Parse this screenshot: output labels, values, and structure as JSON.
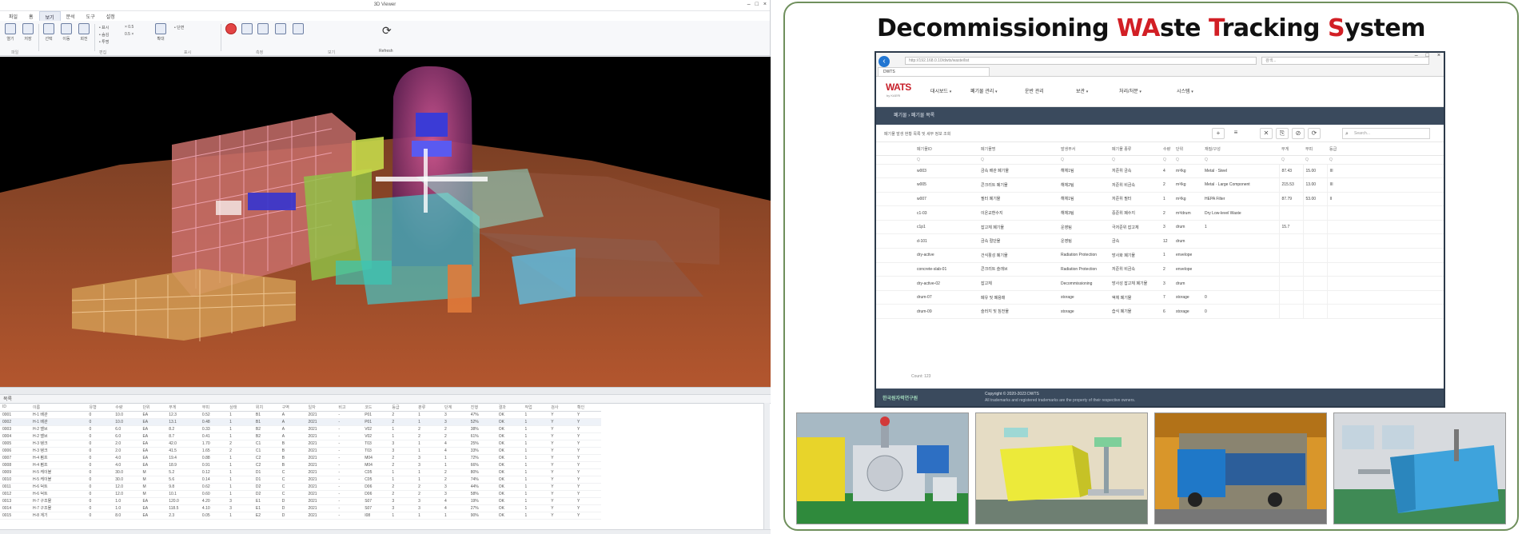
{
  "left_app": {
    "window_title": "3D Viewer",
    "window_controls": [
      "–",
      "□",
      "×"
    ],
    "ribbon_tabs": [
      "파일",
      "홈",
      "보기",
      "분석",
      "도구",
      "설정"
    ],
    "ribbon_active_tab": "보기",
    "ribbon_buttons": [
      "열기",
      "저장",
      "선택",
      "이동",
      "회전",
      "확대"
    ],
    "ribbon_small": [
      "• 표시",
      "• 숨김",
      "• 투명",
      "× 0.5",
      "0.5 ×",
      "• 단면"
    ],
    "ribbon_groups": [
      "파일",
      "편집",
      "표시",
      "측정",
      "보기"
    ],
    "refresh_label": "Refresh",
    "panel_strip": "목록",
    "grid_headers": [
      "ID",
      "이름",
      "유형",
      "수량",
      "단위",
      "무게",
      "부피",
      "상태",
      "위치",
      "구역",
      "일자",
      "비고",
      "코드",
      "등급",
      "분류",
      "단계",
      "진행",
      "결과",
      "작업",
      "검사",
      "확인"
    ],
    "grid_rows": [
      [
        "0001",
        "H-1 배관",
        "0",
        "10.0",
        "EA",
        "12.3",
        "0.52",
        "1",
        "B1",
        "A",
        "2021",
        "-",
        "P01",
        "2",
        "1",
        "3",
        "47%",
        "OK",
        "1",
        "Y",
        "Y"
      ],
      [
        "0002",
        "H-1 배관",
        "0",
        "10.0",
        "EA",
        "13.1",
        "0.48",
        "1",
        "B1",
        "A",
        "2021",
        "-",
        "P01",
        "2",
        "1",
        "3",
        "52%",
        "OK",
        "1",
        "Y",
        "Y"
      ],
      [
        "0003",
        "H-2 밸브",
        "0",
        "6.0",
        "EA",
        "8.2",
        "0.33",
        "1",
        "B2",
        "A",
        "2021",
        "-",
        "V02",
        "1",
        "2",
        "2",
        "38%",
        "OK",
        "1",
        "Y",
        "Y"
      ],
      [
        "0004",
        "H-2 밸브",
        "0",
        "6.0",
        "EA",
        "8.7",
        "0.41",
        "1",
        "B2",
        "A",
        "2021",
        "-",
        "V02",
        "1",
        "2",
        "2",
        "61%",
        "OK",
        "1",
        "Y",
        "Y"
      ],
      [
        "0005",
        "H-3 탱크",
        "0",
        "2.0",
        "EA",
        "42.0",
        "1.70",
        "2",
        "C1",
        "B",
        "2021",
        "-",
        "T03",
        "3",
        "1",
        "4",
        "25%",
        "OK",
        "1",
        "Y",
        "Y"
      ],
      [
        "0006",
        "H-3 탱크",
        "0",
        "2.0",
        "EA",
        "41.5",
        "1.65",
        "2",
        "C1",
        "B",
        "2021",
        "-",
        "T03",
        "3",
        "1",
        "4",
        "33%",
        "OK",
        "1",
        "Y",
        "Y"
      ],
      [
        "0007",
        "H-4 펌프",
        "0",
        "4.0",
        "EA",
        "19.4",
        "0.88",
        "1",
        "C2",
        "B",
        "2021",
        "-",
        "M04",
        "2",
        "3",
        "1",
        "72%",
        "OK",
        "1",
        "Y",
        "Y"
      ],
      [
        "0008",
        "H-4 펌프",
        "0",
        "4.0",
        "EA",
        "18.9",
        "0.91",
        "1",
        "C2",
        "B",
        "2021",
        "-",
        "M04",
        "2",
        "3",
        "1",
        "66%",
        "OK",
        "1",
        "Y",
        "Y"
      ],
      [
        "0009",
        "H-5 케이블",
        "0",
        "30.0",
        "M",
        "5.2",
        "0.12",
        "1",
        "D1",
        "C",
        "2021",
        "-",
        "C05",
        "1",
        "1",
        "2",
        "80%",
        "OK",
        "1",
        "Y",
        "Y"
      ],
      [
        "0010",
        "H-5 케이블",
        "0",
        "30.0",
        "M",
        "5.6",
        "0.14",
        "1",
        "D1",
        "C",
        "2021",
        "-",
        "C05",
        "1",
        "1",
        "2",
        "74%",
        "OK",
        "1",
        "Y",
        "Y"
      ],
      [
        "0011",
        "H-6 덕트",
        "0",
        "12.0",
        "M",
        "9.8",
        "0.62",
        "1",
        "D2",
        "C",
        "2021",
        "-",
        "D06",
        "2",
        "2",
        "3",
        "44%",
        "OK",
        "1",
        "Y",
        "Y"
      ],
      [
        "0012",
        "H-6 덕트",
        "0",
        "12.0",
        "M",
        "10.1",
        "0.60",
        "1",
        "D2",
        "C",
        "2021",
        "-",
        "D06",
        "2",
        "2",
        "3",
        "58%",
        "OK",
        "1",
        "Y",
        "Y"
      ],
      [
        "0013",
        "H-7 구조물",
        "0",
        "1.0",
        "EA",
        "120.0",
        "4.20",
        "3",
        "E1",
        "D",
        "2021",
        "-",
        "S07",
        "3",
        "3",
        "4",
        "19%",
        "OK",
        "1",
        "Y",
        "Y"
      ],
      [
        "0014",
        "H-7 구조물",
        "0",
        "1.0",
        "EA",
        "118.5",
        "4.10",
        "3",
        "E1",
        "D",
        "2021",
        "-",
        "S07",
        "3",
        "3",
        "4",
        "27%",
        "OK",
        "1",
        "Y",
        "Y"
      ],
      [
        "0015",
        "H-8 계기",
        "0",
        "8.0",
        "EA",
        "2.3",
        "0.05",
        "1",
        "E2",
        "D",
        "2021",
        "-",
        "I08",
        "1",
        "1",
        "1",
        "90%",
        "OK",
        "1",
        "Y",
        "Y"
      ]
    ]
  },
  "slide": {
    "title_parts": [
      {
        "text": "Decommissioning ",
        "hl": false
      },
      {
        "text": "WA",
        "hl": true
      },
      {
        "text": "ste ",
        "hl": false
      },
      {
        "text": "T",
        "hl": true
      },
      {
        "text": "racking ",
        "hl": false
      },
      {
        "text": "S",
        "hl": true
      },
      {
        "text": "ystem",
        "hl": false
      }
    ],
    "browser": {
      "url": "http://192.168.0.10/dwts/waste/list",
      "search_placeholder": "검색...",
      "tab_label": "DWTS",
      "window_controls": [
        "–",
        "□",
        "×"
      ]
    },
    "app": {
      "logo": "WATS",
      "logo_sub": "by KAERI",
      "nav": [
        "대시보드",
        "폐기물 관리",
        "운반 관리",
        "보관",
        "처리/처분",
        "시스템"
      ],
      "breadcrumb": "폐기물 › 폐기물 목록",
      "toolbar_caption": "폐기물 발생 현황 목록 및 세부 정보 조회",
      "toolbar_buttons": [
        "+",
        "≡",
        "✕",
        "⎘",
        "⊘",
        "⟳"
      ],
      "search_placeholder": "Search...",
      "columns": [
        "폐기물ID",
        "폐기물명",
        "발생부서",
        "폐기물 종류",
        "수량",
        "단위",
        "재질/구성",
        "무게",
        "부피",
        "등급"
      ],
      "filter_row": [
        "Q",
        "Q",
        "Q",
        "Q",
        "Q",
        "Q",
        "Q",
        "Q",
        "Q",
        "Q"
      ],
      "rows": [
        [
          "w003",
          "금속 배관 폐기물",
          "해체1팀",
          "저준위 금속",
          "4",
          "m³/kg",
          "Metal · Steel",
          "87.43",
          "15.00",
          "III"
        ],
        [
          "w005",
          "콘크리트 폐기물",
          "해체2팀",
          "저준위 비금속",
          "2",
          "m³/kg",
          "Metal · Large Component",
          "215.53",
          "13.00",
          "III"
        ],
        [
          "w007",
          "필터 폐기물",
          "해체1팀",
          "저준위 필터",
          "1",
          "m³/kg",
          "HEPA Filter",
          "87.79",
          "53.00",
          "II"
        ],
        [
          "c1-03",
          "이온교환수지",
          "해체3팀",
          "중준위 폐수지",
          "2",
          "m³/drum",
          "Dry Low-level Waste",
          "",
          "",
          ""
        ],
        [
          "c1p1",
          "잡고체 폐기물",
          "운영팀",
          "극저준위 잡고체",
          "3",
          "drum",
          "1",
          "15.7",
          "",
          ""
        ],
        [
          "d-101",
          "금속 절단물",
          "운영팀",
          "금속",
          "12",
          "drum",
          "",
          "",
          "",
          ""
        ],
        [
          "dry-active",
          "건식활성 폐기물",
          "Radiation Protection",
          "방사화 폐기물",
          "1",
          "envelope",
          "",
          "",
          "",
          ""
        ],
        [
          "concrete-slab-01",
          "콘크리트 슬래브",
          "Radiation Protection",
          "저준위 비금속",
          "2",
          "envelope",
          "",
          "",
          "",
          ""
        ],
        [
          "dry-active-02",
          "잡고체",
          "Decommissioning",
          "방사성 잡고체 폐기물",
          "3",
          "drum",
          "",
          "",
          "",
          ""
        ],
        [
          "drum-07",
          "폐유 및 폐용매",
          "storage",
          "액체 폐기물",
          "7",
          "storage",
          "0",
          "",
          "",
          ""
        ],
        [
          "drum-09",
          "슬러지 및 침전물",
          "storage",
          "습식 폐기물",
          "6",
          "storage",
          "0",
          "",
          "",
          ""
        ]
      ],
      "row_count": "Count: 123",
      "footer_logo": "한국원자력연구원",
      "footer_copy": "Copyright © 2020-2023 DWTS",
      "footer_note": "All trademarks and registered trademarks are the property of their respective owners."
    },
    "photos": [
      {
        "name": "waste-treatment-machine"
      },
      {
        "name": "waste-box-conveyor"
      },
      {
        "name": "transport-truck"
      },
      {
        "name": "storage-facility"
      }
    ]
  }
}
